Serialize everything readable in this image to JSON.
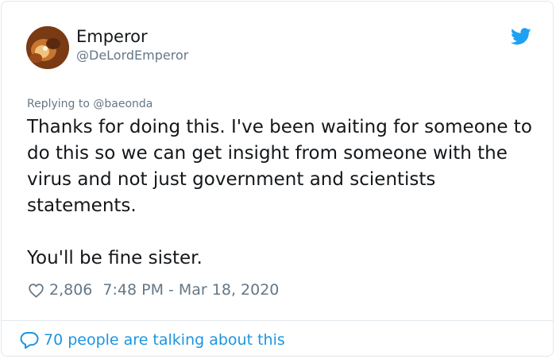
{
  "author": {
    "display_name": "Emperor",
    "handle": "@DeLordEmperor"
  },
  "reply_to": "Replying to @baeonda",
  "tweet": {
    "paragraph_1": "Thanks for doing this. I've been waiting for someone to do this so we can get insight from someone with the virus and not just government and scientists statements.",
    "paragraph_2": "You'll be fine sister."
  },
  "meta": {
    "likes": "2,806",
    "timestamp": "7:48 PM - Mar 18, 2020"
  },
  "footer": {
    "talking_label": "70 people are talking about this"
  },
  "colors": {
    "brand": "#1da1f2",
    "link": "#1b95e0",
    "muted": "#657786"
  },
  "icons": [
    "twitter-bird-icon",
    "heart-icon",
    "comment-bubble-icon"
  ]
}
